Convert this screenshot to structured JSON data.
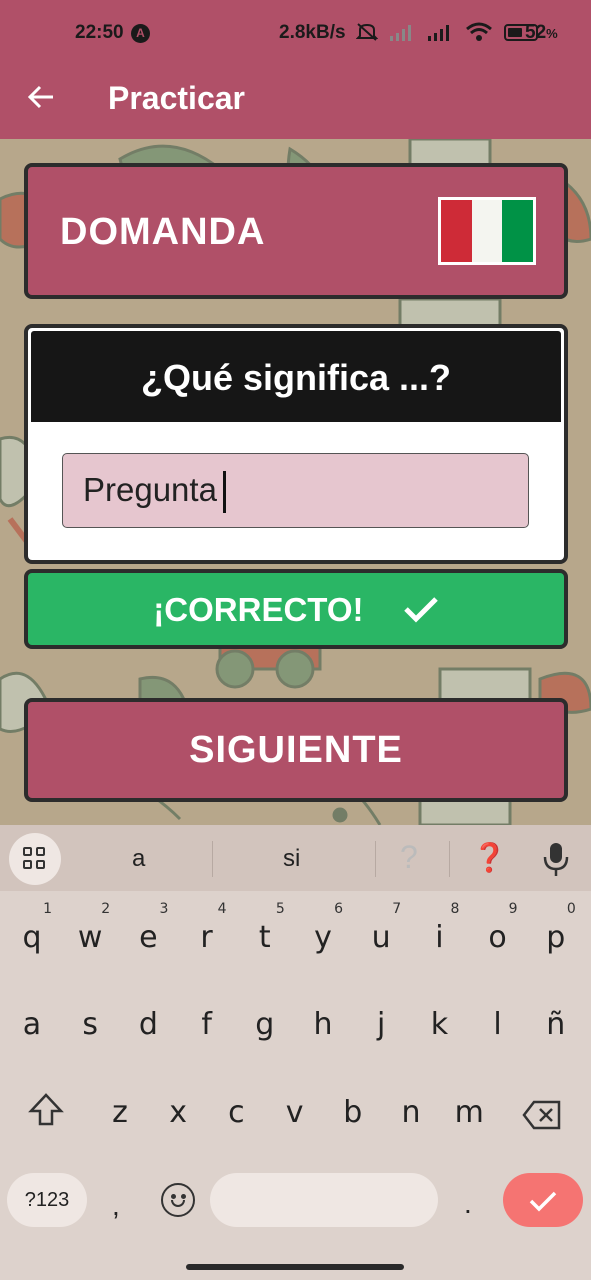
{
  "status_bar": {
    "time": "22:50",
    "net_speed": "2.8kB/s",
    "battery_pct": "52",
    "battery_symbol": "%"
  },
  "app_bar": {
    "back_icon": "arrow-left-icon",
    "title": "Practicar"
  },
  "question_card": {
    "label": "DOMANDA",
    "flag": "italy-flag",
    "flag_colors": [
      "#ce2b37",
      "#f4f5f0",
      "#009246"
    ]
  },
  "prompt_card": {
    "heading": "¿Qué significa ...?",
    "answer_value": "Pregunta"
  },
  "result_button": {
    "label": "¡CORRECTO!",
    "icon": "check-icon",
    "color": "#2ab665"
  },
  "next_button": {
    "label": "SIGUIENTE",
    "color": "#b05068"
  },
  "keyboard": {
    "suggestions": [
      "a",
      "si",
      "?",
      "❓"
    ],
    "row1": [
      {
        "k": "q",
        "n": "1"
      },
      {
        "k": "w",
        "n": "2"
      },
      {
        "k": "e",
        "n": "3"
      },
      {
        "k": "r",
        "n": "4"
      },
      {
        "k": "t",
        "n": "5"
      },
      {
        "k": "y",
        "n": "6"
      },
      {
        "k": "u",
        "n": "7"
      },
      {
        "k": "i",
        "n": "8"
      },
      {
        "k": "o",
        "n": "9"
      },
      {
        "k": "p",
        "n": "0"
      }
    ],
    "row2": [
      "a",
      "s",
      "d",
      "f",
      "g",
      "h",
      "j",
      "k",
      "l",
      "ñ"
    ],
    "row3": [
      "z",
      "x",
      "c",
      "v",
      "b",
      "n",
      "m"
    ],
    "symbols_label": "?123",
    "comma": ",",
    "period": ".",
    "enter_icon": "check-icon",
    "accent": "#f57472"
  }
}
